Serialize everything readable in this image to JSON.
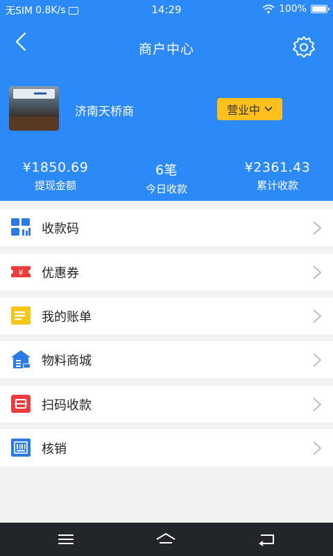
{
  "status_bar": {
    "carrier": "无SIM",
    "speed": "0.8K/s",
    "time": "14:29",
    "battery": "100%"
  },
  "header": {
    "title": "商户中心"
  },
  "store": {
    "name": "济南天桥商",
    "status_label": "营业中"
  },
  "stats": [
    {
      "value": "¥1850.69",
      "label": "提现金额"
    },
    {
      "value": "6笔",
      "label": "今日收款"
    },
    {
      "value": "¥2361.43",
      "label": "累计收款"
    }
  ],
  "menu": [
    {
      "label": "收款码",
      "icon": "qr-grid-icon"
    },
    {
      "label": "优惠券",
      "icon": "coupon-icon"
    },
    {
      "label": "我的账单",
      "icon": "bill-icon"
    },
    {
      "label": "物料商城",
      "icon": "store-house-icon"
    },
    {
      "label": "扫码收款",
      "icon": "scan-icon"
    },
    {
      "label": "核销",
      "icon": "barcode-icon"
    }
  ],
  "colors": {
    "primary": "#2c89f8",
    "status_button": "#ffc01e",
    "nav_bar": "#22262b"
  }
}
